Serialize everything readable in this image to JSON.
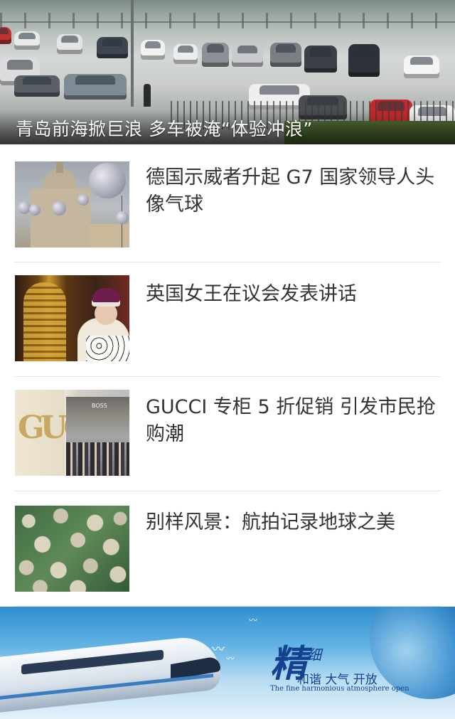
{
  "hero": {
    "caption": "青岛前海掀巨浪 多车被淹“体验冲浪”"
  },
  "news": [
    {
      "title": "德国示威者升起 G7 国家领导人头像气球"
    },
    {
      "title": "英国女王在议会发表讲话"
    },
    {
      "title": "GUCCI 专柜 5 折促销 引发市民抢购潮"
    },
    {
      "title": "别样风景：航拍记录地球之美"
    }
  ],
  "banner": {
    "slogan_cn_big": "精",
    "slogan_cn_small": "细",
    "slogan_cn_line": "和谐 大气 开放",
    "slogan_en": "The fine harmonious atmosphere open"
  },
  "colors": {
    "title_text": "#333333",
    "divider": "#e3e3e3",
    "slogan": "#14418d"
  }
}
